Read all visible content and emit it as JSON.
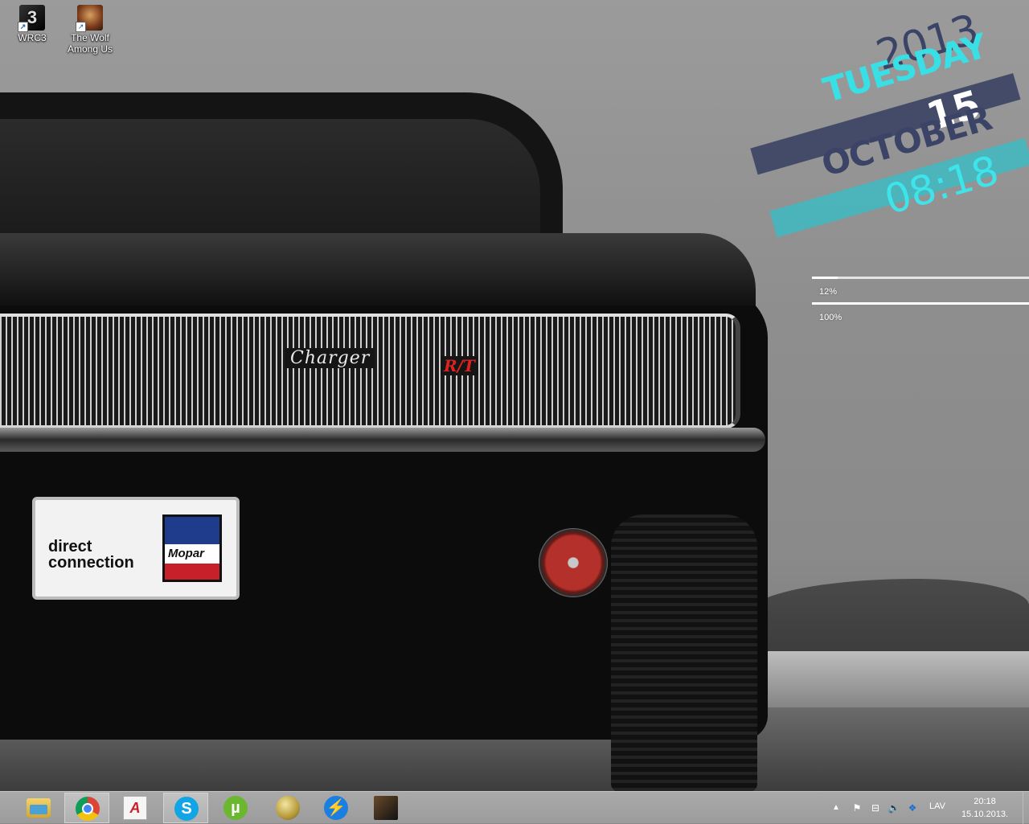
{
  "desktop": {
    "icons": [
      {
        "label": "WRC3",
        "glyph": "3",
        "icon": "wrc3-game-icon"
      },
      {
        "label": "The Wolf\nAmong Us",
        "icon": "wolf-among-us-game-icon"
      }
    ],
    "wallpaper": {
      "badge_charger": "Charger",
      "badge_rt": "R/T",
      "plate_text_line1": "direct",
      "plate_text_line2": "connection",
      "plate_logo": "Mopar"
    }
  },
  "clock_widget": {
    "year": "2013",
    "weekday": "TUESDAY",
    "day": "15",
    "month": "OCTOBER",
    "time": "08:18",
    "colors": {
      "navy": "#3b4466",
      "cyan": "#38e0e6",
      "white": "#ffffff"
    }
  },
  "meters": [
    {
      "label": "12%",
      "value": 0.12
    },
    {
      "label": "100%",
      "value": 1.0
    }
  ],
  "taskbar": {
    "buttons": [
      {
        "name": "file-explorer",
        "active": false
      },
      {
        "name": "google-chrome",
        "active": true
      },
      {
        "name": "app-red-logo",
        "glyph": "A",
        "active": false
      },
      {
        "name": "skype",
        "glyph": "S",
        "active": true
      },
      {
        "name": "utorrent",
        "glyph": "µ",
        "active": false
      },
      {
        "name": "app-globe",
        "active": false
      },
      {
        "name": "app-lightning",
        "glyph": "⚡",
        "active": false
      },
      {
        "name": "app-game",
        "active": false
      }
    ],
    "tray": {
      "arrow": "▲",
      "flag": "⚑",
      "network": "⊟",
      "volume": "🔈",
      "dropbox": "❖",
      "language": "LAV",
      "time": "20:18",
      "date": "15.10.2013."
    }
  }
}
